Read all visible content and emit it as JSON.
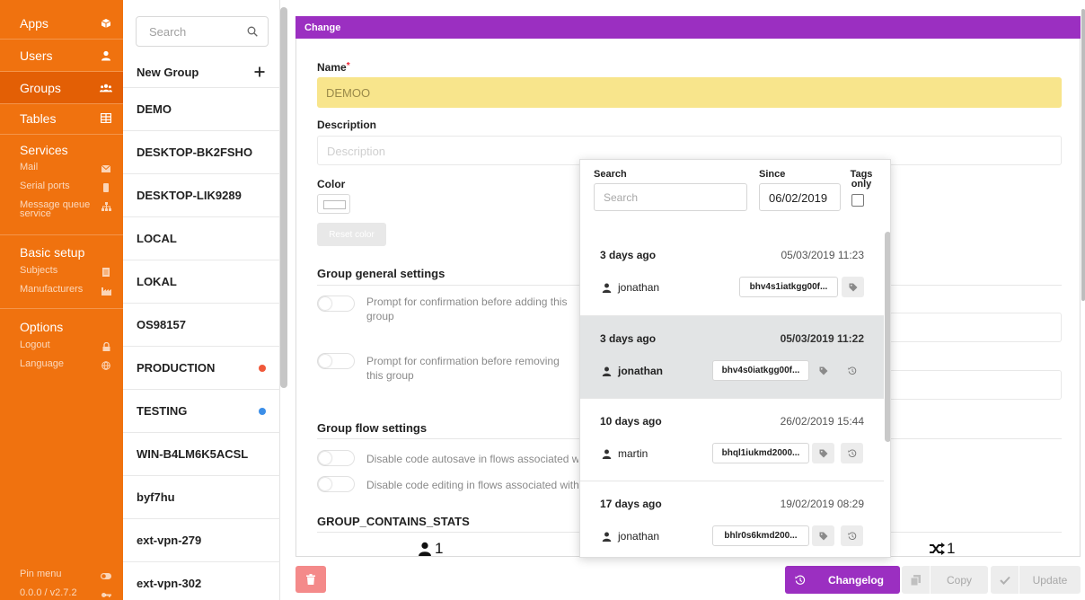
{
  "sidebar": {
    "main_items": [
      {
        "label": "Apps",
        "icon": "cube-icon"
      },
      {
        "label": "Users",
        "icon": "user-icon"
      },
      {
        "label": "Groups",
        "icon": "users-icon"
      },
      {
        "label": "Tables",
        "icon": "table-icon"
      }
    ],
    "services": {
      "heading": "Services",
      "items": [
        {
          "label": "Mail",
          "icon": "mail-icon"
        },
        {
          "label": "Serial ports",
          "icon": "serial-port-icon"
        },
        {
          "label": "Message queue service",
          "icon": "sitemap-icon"
        }
      ]
    },
    "basic_setup": {
      "heading": "Basic setup",
      "items": [
        {
          "label": "Subjects",
          "icon": "document-icon"
        },
        {
          "label": "Manufacturers",
          "icon": "factory-icon"
        }
      ]
    },
    "options": {
      "heading": "Options",
      "items": [
        {
          "label": "Logout",
          "icon": "lock-icon"
        },
        {
          "label": "Language",
          "icon": "globe-icon"
        }
      ]
    },
    "pin_menu": "Pin menu",
    "version": "0.0.0 / v2.7.2"
  },
  "group_list": {
    "search_placeholder": "Search",
    "new_group": "New Group",
    "groups": [
      {
        "name": "DEMO",
        "dot": ""
      },
      {
        "name": "DESKTOP-BK2FSHO",
        "dot": ""
      },
      {
        "name": "DESKTOP-LIK9289",
        "dot": ""
      },
      {
        "name": "LOCAL",
        "dot": ""
      },
      {
        "name": "LOKAL",
        "dot": ""
      },
      {
        "name": "OS98157",
        "dot": ""
      },
      {
        "name": "PRODUCTION",
        "dot": "#f0583a"
      },
      {
        "name": "TESTING",
        "dot": "#3b8ee8"
      },
      {
        "name": "WIN-B4LM6K5ACSL",
        "dot": ""
      },
      {
        "name": "byf7hu",
        "dot": ""
      },
      {
        "name": "ext-vpn-279",
        "dot": ""
      },
      {
        "name": "ext-vpn-302",
        "dot": ""
      }
    ]
  },
  "form": {
    "header": "Change",
    "name_label": "Name",
    "required_mark": "*",
    "name_value": "DEMOO",
    "description_label": "Description",
    "description_placeholder": "Description",
    "color_label": "Color",
    "reset_color": "Reset color",
    "general_settings": "Group general settings",
    "toggle_add": "Prompt for confirmation before adding this group",
    "toggle_remove": "Prompt for confirmation before removing this group",
    "flow_settings": "Group flow settings",
    "toggle_autosave": "Disable code autosave in flows associated with this group",
    "toggle_editing": "Disable code editing in flows associated with this group",
    "stats_heading": "GROUP_CONTAINS_STATS",
    "stat_users": "1",
    "stat_flows": "1"
  },
  "toolbar": {
    "changelog": "Changelog",
    "copy": "Copy",
    "update": "Update"
  },
  "changelog": {
    "search_label": "Search",
    "search_placeholder": "Search",
    "since_label": "Since",
    "since_value": "06/02/2019",
    "tags_only_label": "Tags only",
    "entries": [
      {
        "ago": "3 days ago",
        "date": "05/03/2019 11:23",
        "user": "jonathan",
        "hash": "bhv4s1iatkgg00f...",
        "selected": false,
        "restore": false
      },
      {
        "ago": "3 days ago",
        "date": "05/03/2019 11:22",
        "user": "jonathan",
        "hash": "bhv4s0iatkgg00f...",
        "selected": true,
        "restore": true
      },
      {
        "ago": "10 days ago",
        "date": "26/02/2019 15:44",
        "user": "martin",
        "hash": "bhql1iukmd2000...",
        "selected": false,
        "restore": true
      },
      {
        "ago": "17 days ago",
        "date": "19/02/2019 08:29",
        "user": "jonathan",
        "hash": "bhlr0s6kmd200...",
        "selected": false,
        "restore": true
      }
    ]
  },
  "colors": {
    "sidebar": "#f0720f",
    "accent": "#9b2fc1",
    "name_field": "#f8e58c",
    "delete": "#f48a8a"
  }
}
